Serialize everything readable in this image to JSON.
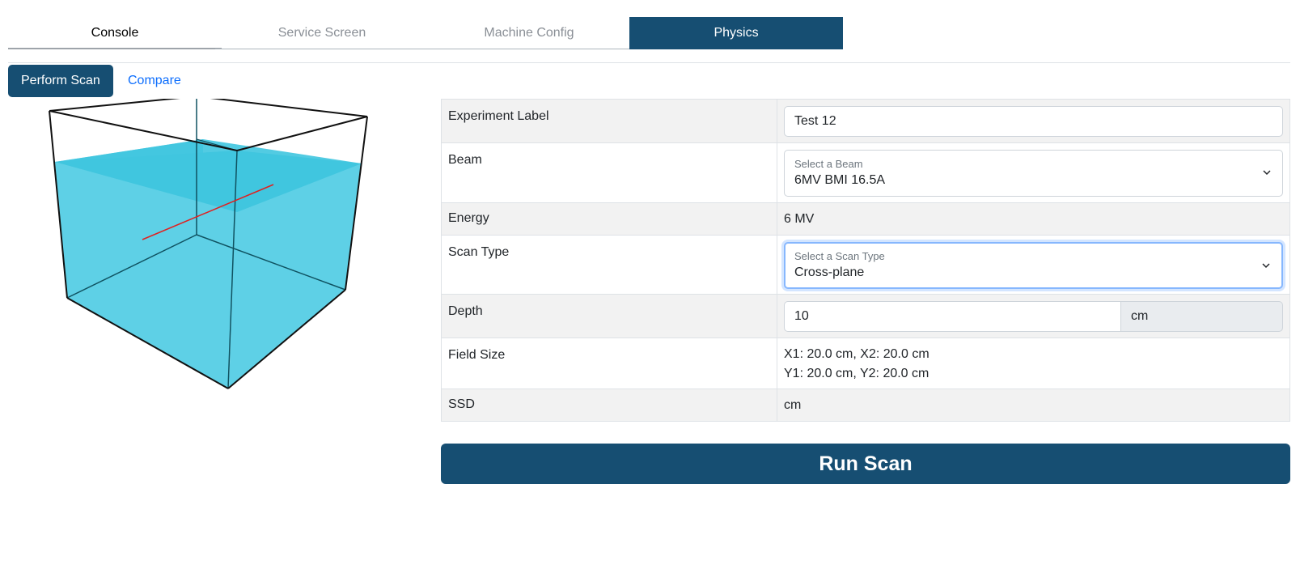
{
  "tabs": [
    {
      "label": "Console"
    },
    {
      "label": "Service Screen"
    },
    {
      "label": "Machine Config"
    },
    {
      "label": "Physics"
    }
  ],
  "subtabs": {
    "perform_scan": "Perform Scan",
    "compare": "Compare"
  },
  "form": {
    "experiment_label": {
      "label": "Experiment Label",
      "value": "Test 12"
    },
    "beam": {
      "label": "Beam",
      "placeholder": "Select a Beam",
      "value": "6MV BMI 16.5A"
    },
    "energy": {
      "label": "Energy",
      "value": "6 MV"
    },
    "scan_type": {
      "label": "Scan Type",
      "placeholder": "Select a Scan Type",
      "value": "Cross-plane"
    },
    "depth": {
      "label": "Depth",
      "value": "10",
      "unit": "cm"
    },
    "field_size": {
      "label": "Field Size",
      "line1": "X1: 20.0 cm, X2: 20.0 cm",
      "line2": "Y1: 20.0 cm, Y2: 20.0 cm"
    },
    "ssd": {
      "label": "SSD",
      "value": "cm"
    }
  },
  "run_button": "Run Scan",
  "colors": {
    "brand": "#164e72",
    "water": "#5ed0e6",
    "water_top": "#3fc5df",
    "scan_line": "#e02020",
    "link": "#0d6efd"
  }
}
